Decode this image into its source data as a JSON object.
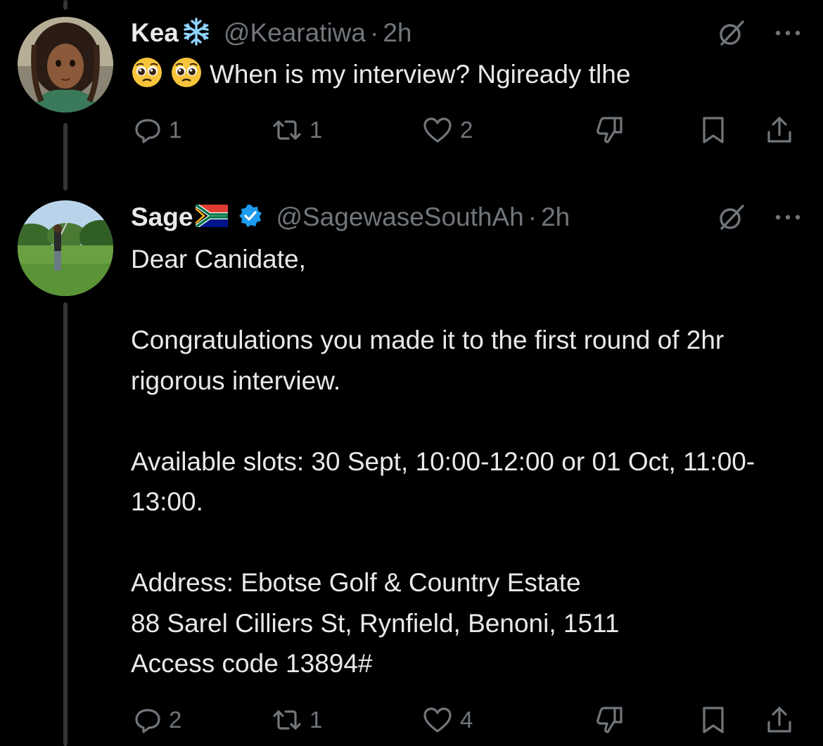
{
  "tweets": [
    {
      "name": "Kea",
      "name_emoji": "snowflake",
      "handle": "@Kearatiwa",
      "dot": "·",
      "time": "2h",
      "text": "When is my interview? Ngiready tlhe",
      "leading_emojis": [
        "pleading-face",
        "pleading-face"
      ],
      "replies": "1",
      "reposts": "1",
      "likes": "2",
      "verified": false
    },
    {
      "name": "Sage",
      "name_emoji": "south-africa-flag",
      "handle": "@SagewaseSouthAh",
      "dot": "·",
      "time": "2h",
      "text": "Dear Canidate,\n\nCongratulations you made it to the first round of 2hr rigorous interview.\n\nAvailable slots: 30 Sept, 10:00-12:00 or 01 Oct, 11:00-13:00.\n\nAddress: Ebotse Golf & Country Estate\n88 Sarel Cilliers St, Rynfield, Benoni, 1511\nAccess code 13894#",
      "replies": "2",
      "reposts": "1",
      "likes": "4",
      "verified": true
    }
  ],
  "colors": {
    "background": "#000000",
    "primary_text": "#e7e9ea",
    "secondary_text": "#71767b",
    "thread_line": "#333639",
    "verified": "#1d9bf0"
  },
  "icons": {
    "reply": "reply-icon",
    "repost": "repost-icon",
    "like": "heart-icon",
    "dislike": "thumbs-down-icon",
    "bookmark": "bookmark-icon",
    "share": "share-icon",
    "grok": "grok-icon",
    "more": "more-icon"
  }
}
